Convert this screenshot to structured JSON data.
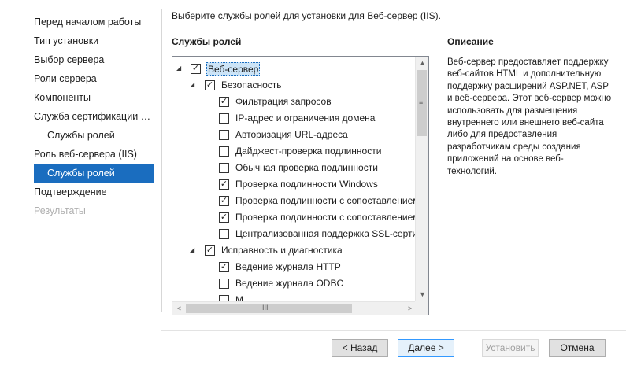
{
  "nav": {
    "items": [
      {
        "label": "Перед началом работы",
        "state": "normal",
        "indent": false
      },
      {
        "label": "Тип установки",
        "state": "normal",
        "indent": false
      },
      {
        "label": "Выбор сервера",
        "state": "normal",
        "indent": false
      },
      {
        "label": "Роли сервера",
        "state": "normal",
        "indent": false
      },
      {
        "label": "Компоненты",
        "state": "normal",
        "indent": false
      },
      {
        "label": "Служба сертификации А...",
        "state": "normal",
        "indent": false
      },
      {
        "label": "Службы ролей",
        "state": "normal",
        "indent": true
      },
      {
        "label": "Роль веб-сервера (IIS)",
        "state": "normal",
        "indent": false
      },
      {
        "label": "Службы ролей",
        "state": "active",
        "indent": true
      },
      {
        "label": "Подтверждение",
        "state": "normal",
        "indent": false
      },
      {
        "label": "Результаты",
        "state": "disabled",
        "indent": false
      }
    ]
  },
  "main": {
    "instruction": "Выберите службы ролей для установки для Веб-сервер (IIS).",
    "role_services_header": "Службы ролей",
    "description_header": "Описание",
    "description_text": "Веб-сервер предоставляет поддержку веб-сайтов HTML и дополнительную поддержку расширений ASP.NET, ASP и веб-сервера. Этот веб-сервер можно использовать для размещения внутреннего или внешнего веб-сайта либо для предоставления разработчикам среды создания приложений на основе веб-технологий."
  },
  "tree": {
    "items": [
      {
        "label": "Веб-сервер",
        "level": 0,
        "checked": true,
        "expander": "◢",
        "selected": true
      },
      {
        "label": "Безопасность",
        "level": 1,
        "checked": true,
        "expander": "◢"
      },
      {
        "label": "Фильтрация запросов",
        "level": 2,
        "checked": true
      },
      {
        "label": "IP-адрес и ограничения домена",
        "level": 2,
        "checked": false
      },
      {
        "label": "Авторизация URL-адреса",
        "level": 2,
        "checked": false
      },
      {
        "label": "Дайджест-проверка подлинности",
        "level": 2,
        "checked": false
      },
      {
        "label": "Обычная проверка подлинности",
        "level": 2,
        "checked": false
      },
      {
        "label": "Проверка подлинности Windows",
        "level": 2,
        "checked": true
      },
      {
        "label": "Проверка подлинности с сопоставлением",
        "level": 2,
        "checked": true
      },
      {
        "label": "Проверка подлинности с сопоставлением",
        "level": 2,
        "checked": true
      },
      {
        "label": "Централизованная поддержка SSL-сертис",
        "level": 2,
        "checked": false
      },
      {
        "label": "Исправность и диагностика",
        "level": 1,
        "checked": true,
        "expander": "◢"
      },
      {
        "label": "Ведение журнала HTTP",
        "level": 2,
        "checked": true
      },
      {
        "label": "Ведение журнала ODBC",
        "level": 2,
        "checked": false
      },
      {
        "label": "М",
        "level": 2,
        "checked": false
      }
    ],
    "check_glyph": "✓",
    "scroll_up": "▲",
    "scroll_down": "▼",
    "scroll_left": "<",
    "scroll_right": ">",
    "v_grip": "≡",
    "h_grip": "III"
  },
  "buttons": {
    "back_prefix": "< ",
    "back_hotkey": "Н",
    "back_rest": "азад",
    "next_label": "Далее >",
    "install_hotkey": "У",
    "install_rest": "становить",
    "cancel_label": "Отмена"
  }
}
